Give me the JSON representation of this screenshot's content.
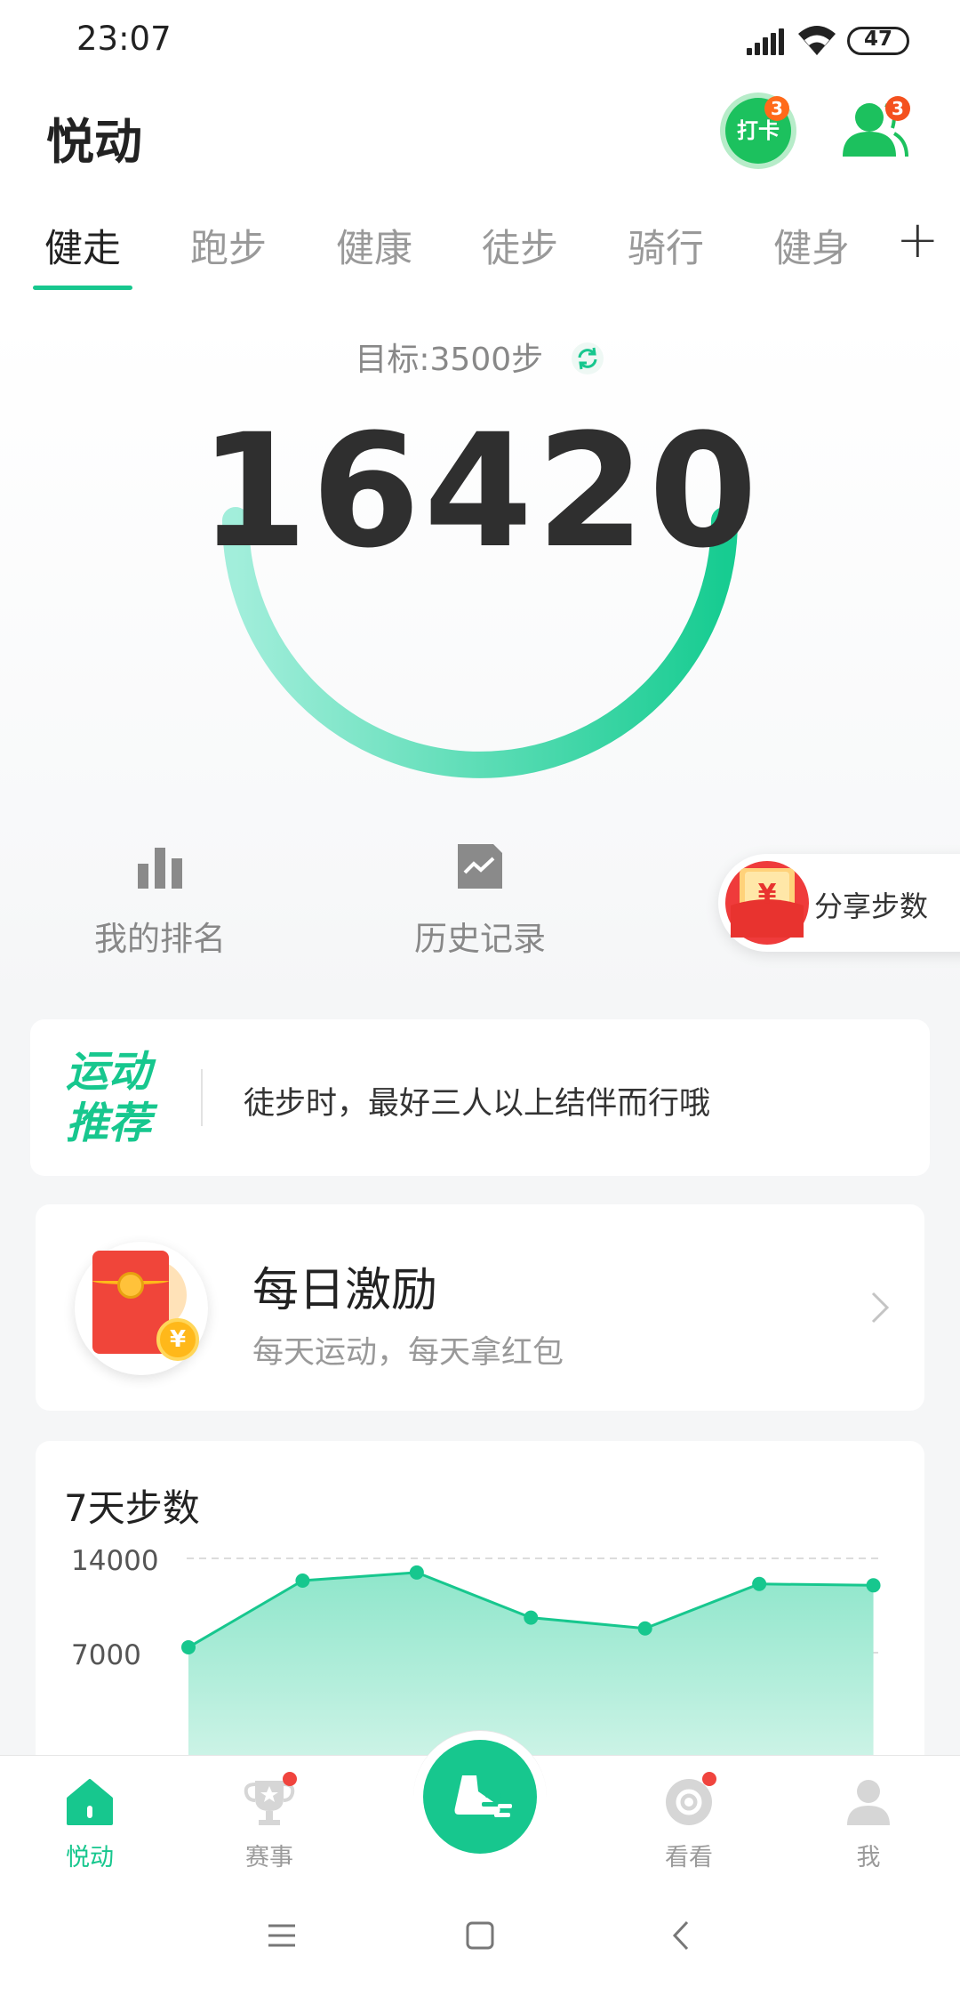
{
  "status_bar": {
    "time": "23:07",
    "battery": "47"
  },
  "header": {
    "title": "悦动",
    "checkin_label": "打卡",
    "checkin_badge": "3",
    "friends_badge": "3"
  },
  "tabs": {
    "items": [
      "健走",
      "跑步",
      "健康",
      "徒步",
      "骑行",
      "健身"
    ],
    "active": "健走",
    "add_label": "+"
  },
  "steps": {
    "goal": "目标:3500步",
    "count": "16420",
    "progress_fraction": 1.0
  },
  "actions": {
    "ranking": "我的排名",
    "history": "历史记录",
    "share": "分享步数",
    "share_currency": "¥"
  },
  "recommend": {
    "logo_line1": "运动",
    "logo_line2": "推荐",
    "text": "徒步时，最好三人以上结伴而行哦"
  },
  "reward": {
    "title": "每日激励",
    "subtitle": "每天运动，每天拿红包",
    "coin": "¥"
  },
  "chart_data": {
    "type": "area",
    "title": "7天步数",
    "y_ticks": [
      "14000",
      "7000"
    ],
    "ylim": [
      0,
      14000
    ],
    "values": [
      7400,
      12350,
      12950,
      9600,
      8800,
      12100,
      12000
    ],
    "color": "#17c78e"
  },
  "bottom_nav": {
    "home": "悦动",
    "events": "赛事",
    "watch": "看看",
    "me": "我"
  },
  "colors": {
    "accent": "#17c78e",
    "badge": "#ff6a1a",
    "red": "#f0443e"
  }
}
